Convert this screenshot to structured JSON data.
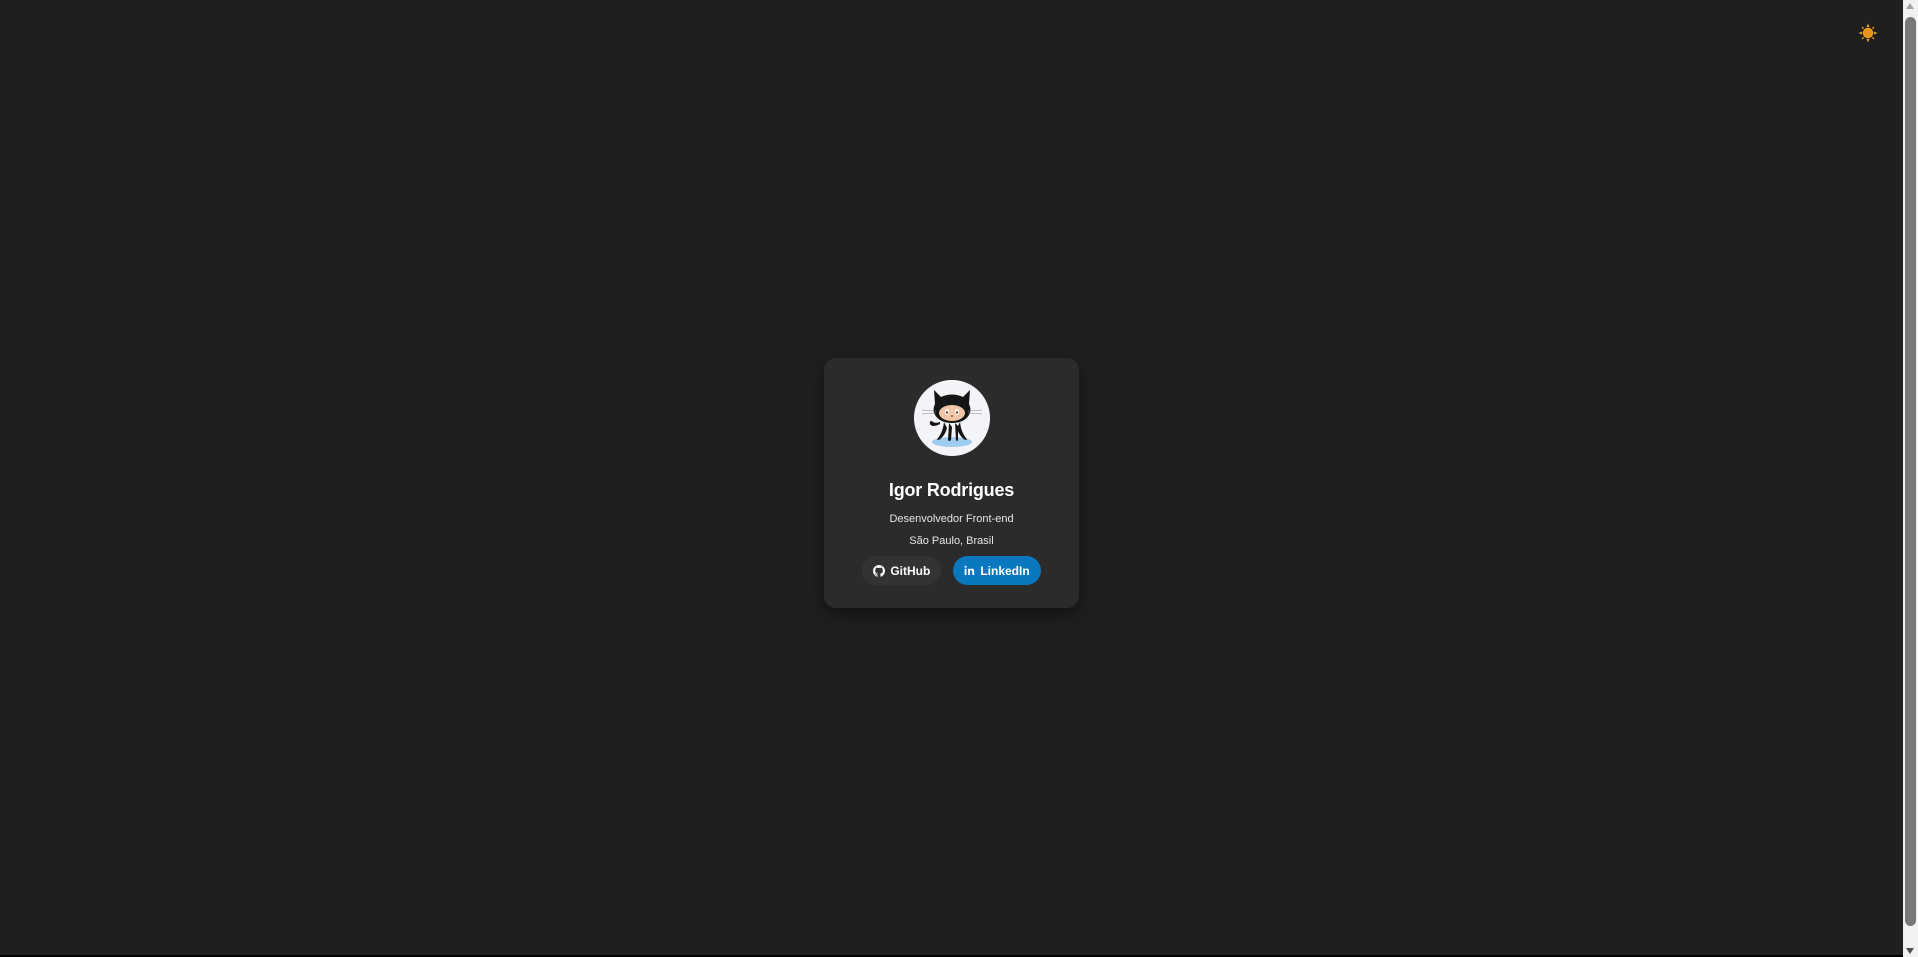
{
  "theme_toggle": {
    "icon": "sun-icon",
    "color": "#f5a623"
  },
  "profile": {
    "name": "Igor Rodrigues",
    "role": "Desenvolvedor Front-end",
    "location": "São Paulo, Brasil",
    "avatar_icon": "octocat-avatar"
  },
  "links": {
    "github_label": "GitHub",
    "linkedin_label": "LinkedIn"
  },
  "colors": {
    "background": "#1f1f1f",
    "card": "#2b2b2b",
    "github_button": "#333333",
    "linkedin_button": "#0a78bf"
  }
}
